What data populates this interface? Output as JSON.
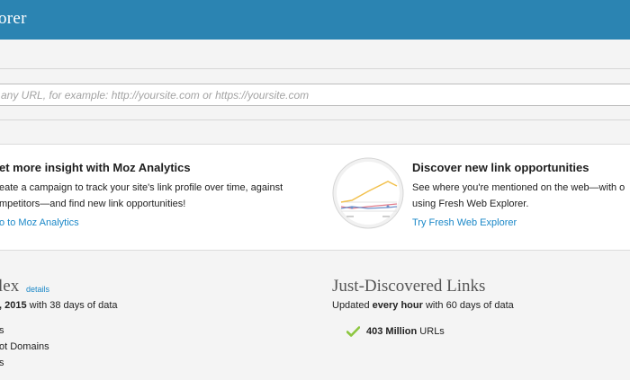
{
  "header": {
    "title": "orer"
  },
  "search": {
    "placeholder": "any URL, for example: http://yoursite.com or https://yoursite.com"
  },
  "promo_left": {
    "title": "et more insight with Moz Analytics",
    "line1": "eate a campaign to track your site's link profile over time, against",
    "line2": "mpetitors—and find new link opportunities!",
    "link": "o to Moz Analytics"
  },
  "promo_right": {
    "title": "Discover new link opportunities",
    "line1": "See where you're mentioned on the web—with o",
    "line2": "using Fresh Web Explorer.",
    "link": "Try Fresh Web Explorer"
  },
  "index": {
    "title": "lex",
    "details_link": "details",
    "date_bold": ", 2015",
    "date_rest": " with 38 days of data",
    "stats": [
      "s",
      "ot Domains",
      "s"
    ]
  },
  "discovered": {
    "title": "Just-Discovered Links",
    "sub_prefix": "Updated ",
    "sub_bold": "every hour",
    "sub_suffix": " with 60 days of data",
    "stat_bold": "403 Million",
    "stat_rest": " URLs"
  },
  "colors": {
    "header_bg": "#2b84b2",
    "link": "#1b88c8",
    "check": "#8cc63f"
  }
}
